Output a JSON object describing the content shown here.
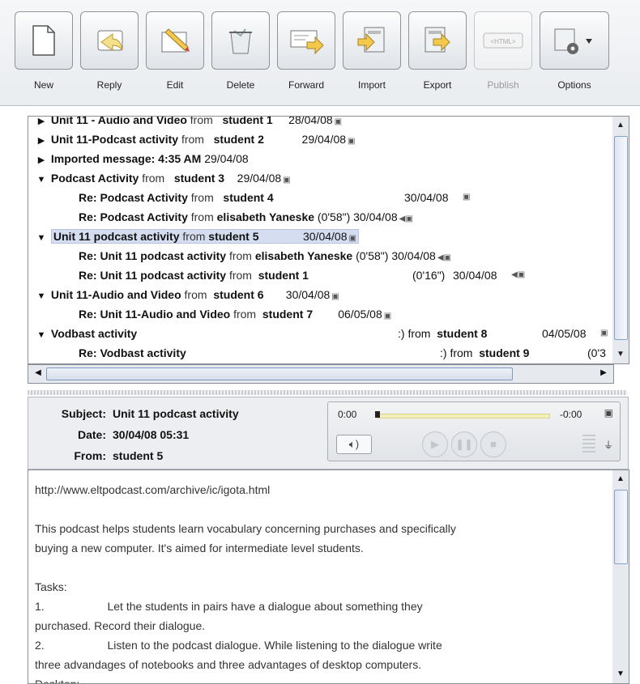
{
  "toolbar": {
    "buttons": [
      {
        "label": "New",
        "icon": "new-page-icon"
      },
      {
        "label": "Reply",
        "icon": "reply-arrow-icon"
      },
      {
        "label": "Edit",
        "icon": "pencil-icon"
      },
      {
        "label": "Delete",
        "icon": "trash-icon"
      },
      {
        "label": "Forward",
        "icon": "forward-envelope-icon"
      },
      {
        "label": "Import",
        "icon": "import-icon"
      },
      {
        "label": "Export",
        "icon": "export-icon"
      },
      {
        "label": "Publish",
        "icon": "html-publish-icon",
        "disabled": true
      },
      {
        "label": "Options",
        "icon": "gear-options-icon"
      }
    ]
  },
  "messages": [
    {
      "subject": "Unit 11 - Audio and Video",
      "from": "student 1",
      "date": "28/04/08"
    },
    {
      "subject": "Unit 11-Podcast activity",
      "from": "student 2",
      "date": "29/04/08"
    },
    {
      "subject": "Imported message: 4:35 AM",
      "date": "29/04/08"
    },
    {
      "subject": "Podcast Activity",
      "from": "student 3",
      "date": "29/04/08"
    },
    {
      "subject": "Re: Podcast Activity",
      "from": "student 4",
      "date": "30/04/08"
    },
    {
      "subject": "Re: Podcast Activity",
      "from": "elisabeth Yaneske",
      "duration": "(0'58\")",
      "date": "30/04/08"
    },
    {
      "subject": "Unit 11 podcast activity",
      "from": "student 5",
      "date": "30/04/08"
    },
    {
      "subject": "Re: Unit 11 podcast activity",
      "from": "elisabeth Yaneske",
      "duration": "(0'58\")",
      "date": "30/04/08"
    },
    {
      "subject": "Re: Unit 11 podcast activity",
      "from": "student 1",
      "duration": "(0'16\")",
      "date": "30/04/08"
    },
    {
      "subject": "Unit 11-Audio and Video",
      "from": "student 6",
      "date": "30/04/08"
    },
    {
      "subject": "Re: Unit 11-Audio and Video",
      "from": "student 7",
      "date": "06/05/08"
    },
    {
      "subject": "Vodbast activity",
      "from_prefix": ":) from",
      "from": "student 8",
      "date": "04/05/08"
    },
    {
      "subject": "Re: Vodbast activity",
      "from_prefix": ":) from",
      "from": "student 9",
      "duration": "(0'3"
    }
  ],
  "from_word": "from",
  "header": {
    "subject_label": "Subject:",
    "subject": "Unit 11 podcast activity",
    "date_label": "Date:",
    "date": "30/04/08 05:31",
    "from_label": "From:",
    "from": "student 5"
  },
  "player": {
    "elapsed": "0:00",
    "remaining": "-0:00",
    "progress": 0
  },
  "body": [
    "http://www.eltpodcast.com/archive/ic/igota.html",
    "",
    "This podcast helps students learn vocabulary concerning  purchases and specifically",
    "buying a new computer. It's aimed for intermediate level students.",
    "",
    "Tasks:",
    "1.                    Let the students in pairs have a dialogue about something they",
    "purchased. Record their dialogue.",
    "2.                    Listen to the podcast dialogue. While listening to the dialogue write",
    "three advandages of notebooks and three advantages of desktop computers.",
    "Desktop:"
  ]
}
